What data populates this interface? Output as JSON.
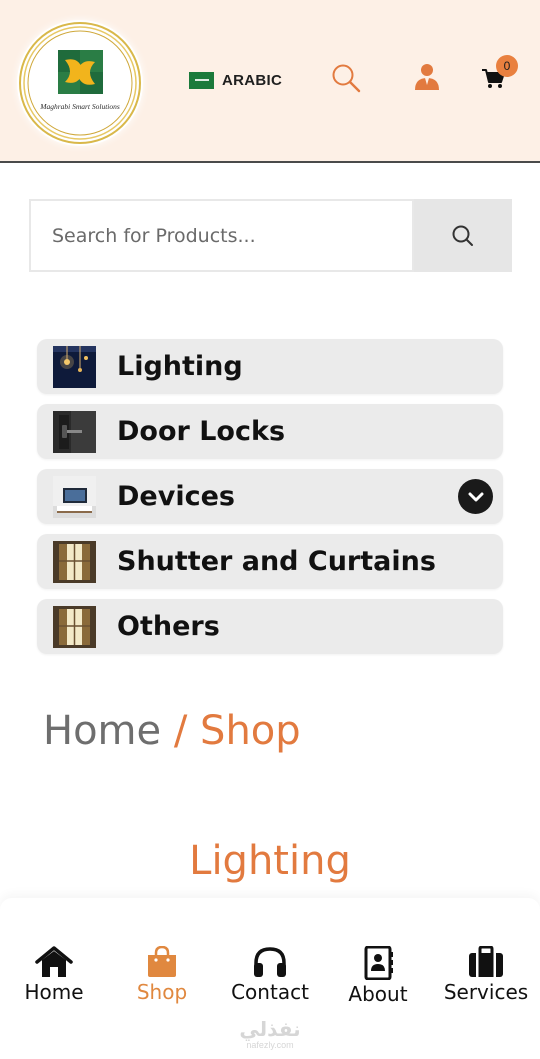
{
  "header": {
    "logo_text": "Maghrabi Smart Solutions",
    "language_label": "ARABIC",
    "cart_count": "0",
    "colors": {
      "background": "#fdf0e6",
      "accent": "#e9803f"
    },
    "icons": [
      "search-icon",
      "user-icon",
      "cart-icon",
      "saudi-flag-icon"
    ]
  },
  "search": {
    "placeholder": "Search for Products...",
    "value": ""
  },
  "categories": [
    {
      "label": "Lighting",
      "thumb": "lighting-thumbnail"
    },
    {
      "label": "Door Locks",
      "thumb": "door-lock-thumbnail"
    },
    {
      "label": "Devices",
      "thumb": "devices-thumbnail",
      "expandable": true
    },
    {
      "label": "Shutter and Curtains",
      "thumb": "curtains-thumbnail"
    },
    {
      "label": "Others",
      "thumb": "curtains-thumbnail"
    }
  ],
  "breadcrumb": {
    "home": "Home",
    "separator": "/",
    "current": "Shop"
  },
  "section_title": "Lighting",
  "bottom_nav": {
    "active": "Shop",
    "items": [
      {
        "label": "Home",
        "icon": "home-icon"
      },
      {
        "label": "Shop",
        "icon": "shopping-bag-icon"
      },
      {
        "label": "Contact",
        "icon": "headphones-icon"
      },
      {
        "label": "About",
        "icon": "contact-book-icon"
      },
      {
        "label": "Services",
        "icon": "briefcase-icon"
      }
    ]
  },
  "watermark": {
    "main": "نفذلي",
    "sub": "nafezly.com"
  },
  "colors": {
    "accent": "#e27a3f",
    "category_bg": "#ebebeb",
    "active_nav": "#e0883f"
  }
}
